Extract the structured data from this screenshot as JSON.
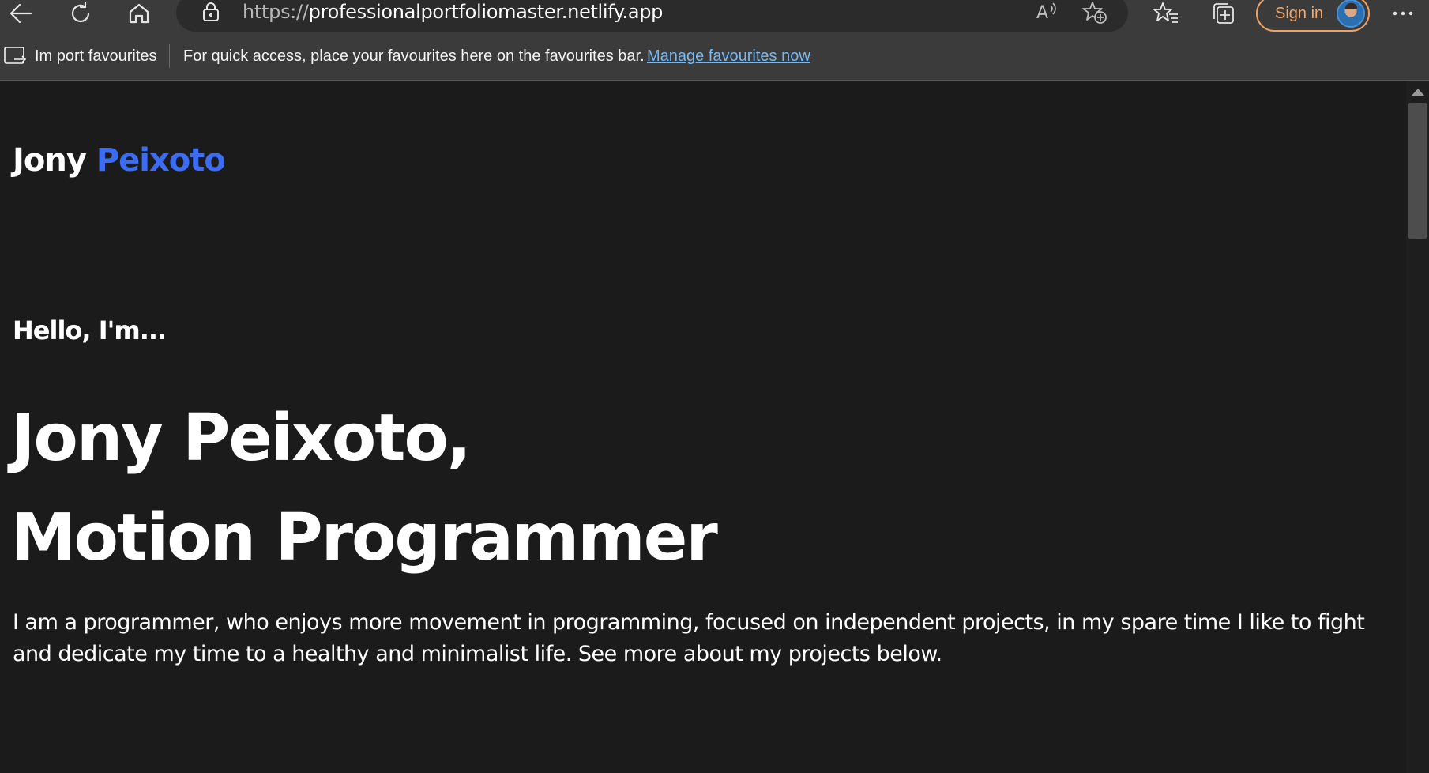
{
  "browser": {
    "url_protocol": "https://",
    "url_host": "professionalportfoliomaster.netlify.app",
    "sign_in_label": "Sign in",
    "icons": [
      "back-icon",
      "refresh-icon",
      "home-icon",
      "lock-icon",
      "read-aloud-icon",
      "add-favourite-icon",
      "favourites-icon",
      "collections-icon",
      "more-icon"
    ]
  },
  "favourites_bar": {
    "import_label": "Im port favourites",
    "hint": "For quick access, place your favourites here on the favourites bar.",
    "manage_link": "Manage favourites now"
  },
  "page": {
    "logo_first": "Jony ",
    "logo_accent": "Peixoto",
    "greeting": "Hello, I'm...",
    "headline_line1": "Jony Peixoto,",
    "headline_line2": "Motion Programmer",
    "intro": "I am a programmer, who enjoys more movement in programming, focused on independent projects, in my spare time I like to fight and dedicate my time to a healthy and minimalist life. See more about my projects below."
  },
  "colors": {
    "background": "#1b1b1b",
    "accent": "#3b6cf2",
    "link": "#77b8f0",
    "signin": "#f3a86a"
  }
}
